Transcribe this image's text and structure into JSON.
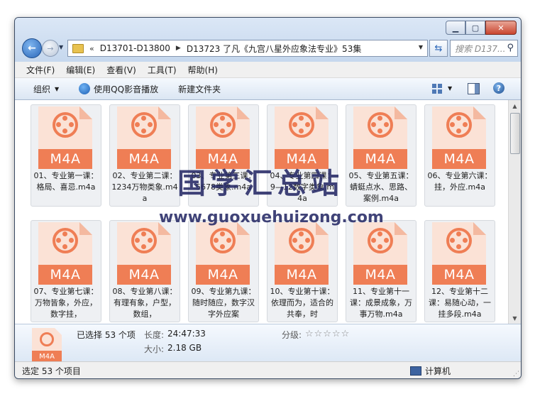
{
  "window": {
    "caption_buttons": [
      "minimize",
      "maximize",
      "close"
    ],
    "back_icon": "back-arrow-icon",
    "forward_icon": "forward-arrow-icon"
  },
  "address": {
    "chevron": "«",
    "crumbs": [
      "D13701-D13800",
      "D13723 了凡《九宫八星外应象法专业》53集"
    ]
  },
  "search": {
    "placeholder": "搜索 D137..."
  },
  "menu": {
    "items": [
      "文件(F)",
      "编辑(E)",
      "查看(V)",
      "工具(T)",
      "帮助(H)"
    ]
  },
  "toolbar": {
    "organize": "组织",
    "qq_play": "使用QQ影音播放",
    "new_folder": "新建文件夹",
    "help": "?"
  },
  "file_icon": {
    "label": "M4A",
    "accent": "#ef7e55",
    "light": "#fbe2d6"
  },
  "files": [
    {
      "name": "01、专业第一课：格局、喜忌.m4a"
    },
    {
      "name": "02、专业第二课：1234万物类象.m4a"
    },
    {
      "name": "03、专业第三课：5678类象.m4a"
    },
    {
      "name": "04、专业第四课：9—12数字类象.m4a"
    },
    {
      "name": "05、专业第五课：蜻蜓点水、思路、案例.m4a"
    },
    {
      "name": "06、专业第六课：挂，外应.m4a"
    },
    {
      "name": "07、专业第七课：万物皆象，外应，数字挂，"
    },
    {
      "name": "08、专业第八课：有理有象，户型，数组，"
    },
    {
      "name": "09、专业第九课：随时随应，数字汉字外应案"
    },
    {
      "name": "10、专业第十课：依理而为，适合的共奉，时"
    },
    {
      "name": "11、专业第十一课：成景成象，万事万物.m4a"
    },
    {
      "name": "12、专业第十二课：易随心动，一挂多段.m4a"
    }
  ],
  "details": {
    "selected": "已选择 53 个项",
    "length_label": "长度:",
    "length_value": "24:47:33",
    "size_label": "大小:",
    "size_value": "2.18 GB",
    "rating_label": "分级:",
    "rating_stars": "☆☆☆☆☆"
  },
  "status": {
    "left": "选定 53 个项目",
    "right": "计算机"
  },
  "watermark": {
    "cn": "国学汇总站",
    "en": "www.guoxuehuizong.com"
  }
}
